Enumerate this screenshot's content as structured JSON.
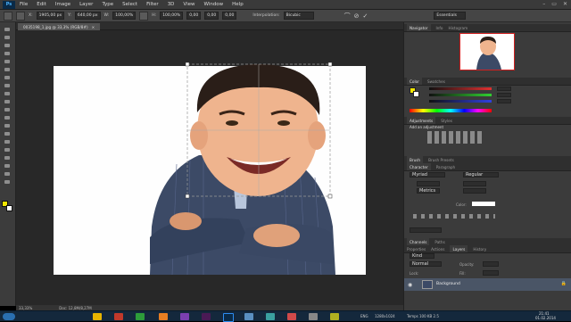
{
  "app": {
    "logo": "Ps",
    "menu": [
      "File",
      "Edit",
      "Image",
      "Layer",
      "Type",
      "Select",
      "Filter",
      "3D",
      "View",
      "Window",
      "Help"
    ],
    "window_controls": [
      "–",
      "▭",
      "✕"
    ]
  },
  "options": {
    "x_label": "X:",
    "x_value": "1905,00 px",
    "y_label": "Y:",
    "y_value": "640,00 px",
    "w_label": "W:",
    "w_value": "100,00%",
    "h_label": "H:",
    "h_value": "100,00%",
    "angle": "0,00",
    "h2": "0,00",
    "v2": "0,00",
    "interp_label": "Interpolation:",
    "interp_value": "Bicubic",
    "workspace": "Essentials"
  },
  "document": {
    "tab_title": "0035198_1.jpg @ 33,3% (RGB/8#)",
    "status_zoom": "33,33%",
    "status_doc": "Doc: 12,8M/8,27M"
  },
  "navigator": {
    "tabs": [
      "Navigator",
      "Info",
      "Histogram"
    ]
  },
  "color": {
    "tabs": [
      "Color",
      "Swatches"
    ],
    "r": "",
    "g": "",
    "b": ""
  },
  "adjustments": {
    "tabs": [
      "Adjustments",
      "Styles"
    ],
    "heading": "Add an adjustment"
  },
  "brush": {
    "tabs": [
      "Brush",
      "Brush Presets"
    ]
  },
  "character": {
    "tabs": [
      "Character",
      "Paragraph"
    ],
    "font": "Myriad",
    "style": "Regular",
    "tracking_label": "Metrics",
    "color_label": "Color:"
  },
  "layers": {
    "tabs": [
      "Channels",
      "Paths"
    ],
    "tabs2": [
      "Properties",
      "Actions",
      "Layers",
      "History"
    ],
    "kind": "Kind",
    "mode": "Normal",
    "opacity_label": "Opacity:",
    "fill_label": "Fill:",
    "lock_label": "Lock:",
    "layer_name": "Background"
  },
  "taskbar": {
    "time": "21:41",
    "date": "01.02.2014",
    "lang": "ENG",
    "resolution": "1280x1024",
    "sysinfo": "Temps 100 KB 2.5"
  },
  "colors": {
    "accent": "#2d8cf0",
    "canvas_bg": "#282828",
    "panel_bg": "#3b3b3b",
    "taskbar": "#14283c"
  }
}
